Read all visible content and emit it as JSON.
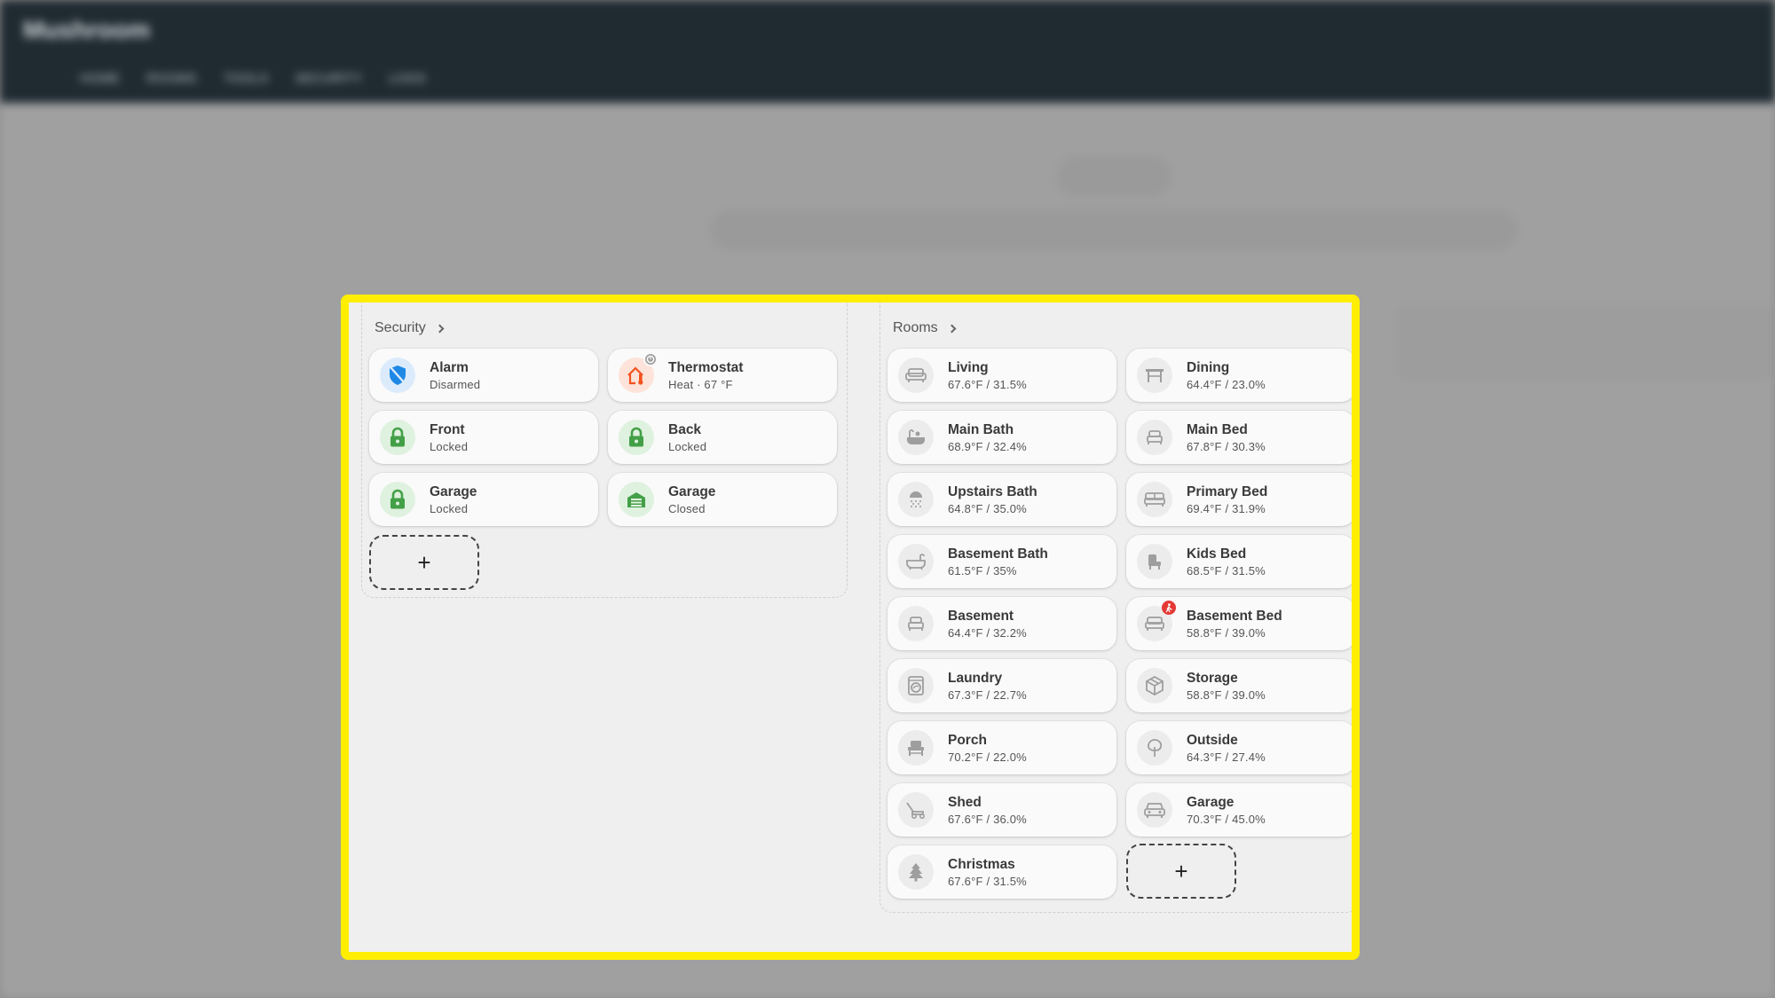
{
  "background": {
    "app_title": "Mushroom",
    "tabs": [
      "HOME",
      "ROOMS",
      "TOOLS",
      "SECURITY",
      "LOGS"
    ]
  },
  "colors": {
    "highlight": "#ffee00",
    "security_blue": "#1e88e5",
    "heat_orange": "#f4511e",
    "lock_green": "#43a047",
    "room_grey": "#9e9e9e",
    "alert_red": "#e53935"
  },
  "security": {
    "title": "Security",
    "tiles": [
      {
        "name": "Alarm",
        "state": "Disarmed",
        "icon": "shield-off-icon"
      },
      {
        "name": "Thermostat",
        "state": "Heat · 67 °F",
        "icon": "home-thermometer-icon"
      },
      {
        "name": "Front",
        "state": "Locked",
        "icon": "lock-icon"
      },
      {
        "name": "Back",
        "state": "Locked",
        "icon": "lock-icon"
      },
      {
        "name": "Garage",
        "state": "Locked",
        "icon": "lock-icon"
      },
      {
        "name": "Garage",
        "state": "Closed",
        "icon": "garage-door-icon"
      }
    ],
    "add_label": "+"
  },
  "rooms": {
    "title": "Rooms",
    "tiles": [
      {
        "name": "Living",
        "state": "67.6°F / 31.5%",
        "icon": "sofa-icon"
      },
      {
        "name": "Dining",
        "state": "64.4°F / 23.0%",
        "icon": "table-icon"
      },
      {
        "name": "Main Bath",
        "state": "68.9°F / 32.4%",
        "icon": "bathtub-icon"
      },
      {
        "name": "Main Bed",
        "state": "67.8°F / 30.3%",
        "icon": "bed-icon"
      },
      {
        "name": "Upstairs Bath",
        "state": "64.8°F / 35.0%",
        "icon": "shower-icon"
      },
      {
        "name": "Primary Bed",
        "state": "69.4°F / 31.9%",
        "icon": "bed-double-icon"
      },
      {
        "name": "Basement Bath",
        "state": "61.5°F / 35%",
        "icon": "bathtub-icon"
      },
      {
        "name": "Kids Bed",
        "state": "68.5°F / 31.5%",
        "icon": "chair-icon"
      },
      {
        "name": "Basement",
        "state": "64.4°F / 32.2%",
        "icon": "bed-icon"
      },
      {
        "name": "Basement Bed",
        "state": "58.8°F / 39.0%",
        "icon": "bed-icon"
      },
      {
        "name": "Laundry",
        "state": "67.3°F / 22.7%",
        "icon": "washing-machine-icon"
      },
      {
        "name": "Storage",
        "state": "58.8°F / 39.0%",
        "icon": "package-icon"
      },
      {
        "name": "Porch",
        "state": "70.2°F / 22.0%",
        "icon": "outdoor-chair-icon"
      },
      {
        "name": "Outside",
        "state": "64.3°F / 27.4%",
        "icon": "tree-icon"
      },
      {
        "name": "Shed",
        "state": "67.6°F / 36.0%",
        "icon": "mower-icon"
      },
      {
        "name": "Garage",
        "state": "70.3°F / 45.0%",
        "icon": "car-icon"
      },
      {
        "name": "Christmas",
        "state": "67.6°F / 31.5%",
        "icon": "pine-tree-icon"
      }
    ],
    "add_label": "+"
  }
}
